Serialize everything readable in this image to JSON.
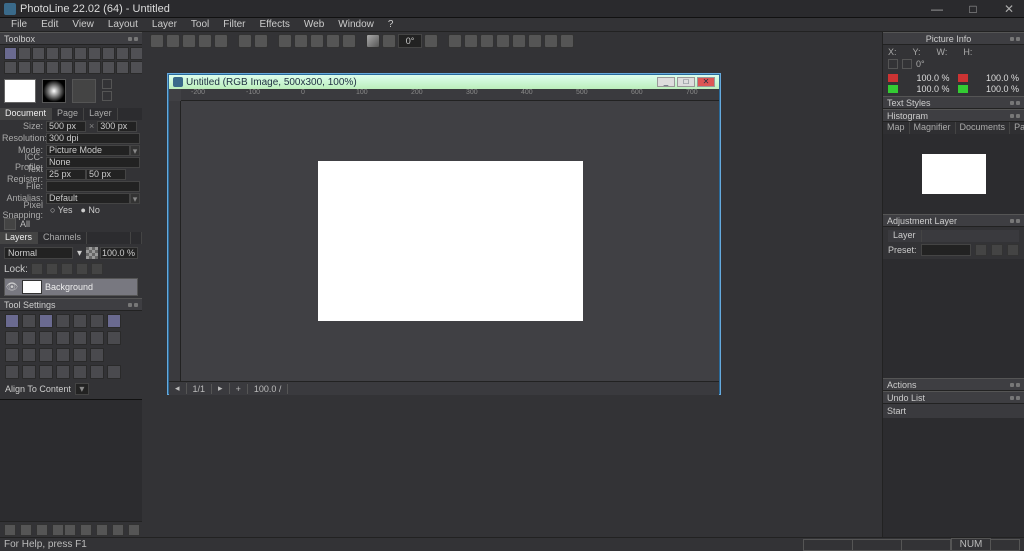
{
  "window": {
    "title": "PhotoLine 22.02 (64) - Untitled",
    "min": "—",
    "max": "□",
    "close": "✕"
  },
  "menu": [
    "File",
    "Edit",
    "View",
    "Layout",
    "Layer",
    "Tool",
    "Filter",
    "Effects",
    "Web",
    "Window",
    "?"
  ],
  "toolbox": {
    "title": "Toolbox"
  },
  "document_props": {
    "tabs": [
      "Document",
      "Page",
      "Layer"
    ],
    "active_tab": 0,
    "rows": {
      "size_label": "Size:",
      "width": "500 px",
      "height": "300 px",
      "res_label": "Resolution:",
      "res": "300 dpi",
      "mode_label": "Mode:",
      "mode": "Picture Mode",
      "icc_label": "ICC-Profile:",
      "icc": "None",
      "reg_label": "Text Register:",
      "reg_a": "25 px",
      "reg_b": "50 px",
      "file_label": "File:",
      "file": "",
      "aa_label": "Antialias:",
      "aa": "Default",
      "snap_label": "Pixel Snapping:",
      "snap_yes": "Yes",
      "snap_no": "No"
    }
  },
  "browser": {
    "all": "All"
  },
  "layers": {
    "title": "Layers",
    "tabs": [
      "Layers",
      "Channels"
    ],
    "blend": "Normal",
    "opacity": "100.0 %",
    "lock_label": "Lock:",
    "item_name": "Background"
  },
  "tool_settings": {
    "title": "Tool Settings",
    "align": "Align To Content"
  },
  "doc_window": {
    "title": "Untitled (RGB Image, 500x300, 100%)",
    "status_page": "1/1",
    "status_zoom": "100.0 /",
    "ruler_ticks": [
      "-200",
      "-100",
      "0",
      "100",
      "200",
      "300",
      "400",
      "500",
      "600",
      "700"
    ]
  },
  "picture_info": {
    "title": "Picture Info",
    "X": "X:",
    "Y": "Y:",
    "W": "W:",
    "H": "H:",
    "angle": "0°",
    "left_vals": [
      "100.0 %",
      "100.0 %"
    ],
    "right_vals": [
      "100.0 %",
      "100.0 %"
    ]
  },
  "right_panels": {
    "text_styles": "Text Styles",
    "histogram": "Histogram",
    "tabs": [
      "Map",
      "Magnifier",
      "Documents",
      "Pages"
    ],
    "adjustment": "Adjustment Layer",
    "layer_tab": "Layer",
    "preset_label": "Preset:",
    "actions": "Actions",
    "undo": "Undo List",
    "undo_start": "Start"
  },
  "statusbar": {
    "help": "For Help, press F1",
    "num": "NUM"
  },
  "top_tool_deg": "0°"
}
